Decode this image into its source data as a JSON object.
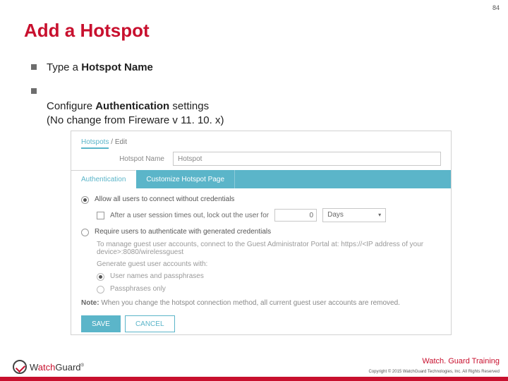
{
  "page_number": "84",
  "title": "Add a Hotspot",
  "bullets": [
    {
      "pre": "Type a ",
      "bold": "Hotspot Name",
      "post": ""
    },
    {
      "pre": "Configure ",
      "bold": "Authentication",
      "post": " settings\n(No change from Fireware v 11. 10. x)"
    }
  ],
  "shot": {
    "breadcrumb": {
      "root": "Hotspots",
      "sep": "/",
      "current": "Edit"
    },
    "hotspot_label": "Hotspot Name",
    "hotspot_value": "Hotspot",
    "tabs": {
      "auth": "Authentication",
      "custom": "Customize Hotspot Page"
    },
    "opt_allow": "Allow all users to connect without credentials",
    "lockout_label": "After a user session times out, lock out the user for",
    "lockout_value": "0",
    "lockout_unit": "Days",
    "opt_require": "Require users to authenticate with generated credentials",
    "manage_hint": "To manage guest user accounts, connect to the Guest Administrator Portal at: https://<IP address of your device>:8080/wirelessguest",
    "gen_label": "Generate guest user accounts with:",
    "gen_opt1": "User names and passphrases",
    "gen_opt2": "Passphrases only",
    "note_label": "Note:",
    "note_text": "When you change the hotspot connection method, all current guest user accounts are removed.",
    "save": "SAVE",
    "cancel": "CANCEL"
  },
  "footer": {
    "training": "Watch. Guard Training",
    "copyright": "Copyright © 2015 WatchGuard Technologies, Inc. All Rights Reserved",
    "logo_a": "W",
    "logo_b": "atch",
    "logo_c": "G",
    "logo_d": "uard"
  }
}
